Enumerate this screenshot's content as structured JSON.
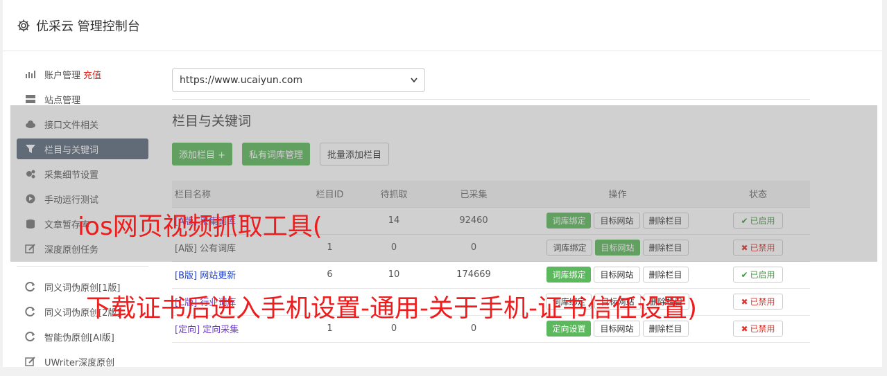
{
  "header": {
    "title": "优采云 管理控制台"
  },
  "sidebar": {
    "items": [
      {
        "label": "账户管理",
        "extra": "充值",
        "icon": "bar-chart-icon"
      },
      {
        "label": "站点管理",
        "icon": "server-icon"
      },
      {
        "label": "接口文件相关",
        "icon": "cloud-upload-icon"
      },
      {
        "label": "栏目与关键词",
        "icon": "filter-icon",
        "active": true
      },
      {
        "label": "采集细节设置",
        "icon": "cogs-icon"
      },
      {
        "label": "手动运行测试",
        "icon": "play-icon"
      },
      {
        "label": "文章暂存库",
        "icon": "database-icon"
      },
      {
        "label": "深度原创任务",
        "icon": "edit-icon"
      }
    ],
    "items2": [
      {
        "label": "同义词伪原创[1版]",
        "icon": "refresh-icon"
      },
      {
        "label": "同义词伪原创[2版]",
        "icon": "refresh-icon"
      },
      {
        "label": "智能伪原创[AI版]",
        "icon": "refresh-icon"
      },
      {
        "label": "UWriter深度原创",
        "icon": "edit-icon"
      }
    ]
  },
  "main": {
    "site_select": "https://www.ucaiyun.com",
    "section_title": "栏目与关键词",
    "buttons": {
      "add": "添加栏目 +",
      "private": "私有词库管理",
      "batch": "批量添加栏目"
    },
    "table": {
      "headers": [
        "栏目名称",
        "栏目ID",
        "待抓取",
        "已采集",
        "操作",
        "状态"
      ],
      "rows": [
        {
          "name": "[A版] 采集词库",
          "id": "",
          "pending": "14",
          "collected": "92460",
          "op1": "词库绑定",
          "op1_green": true,
          "op2": "目标网站",
          "op2_green": false,
          "op3": "删除栏目",
          "status": "已启用",
          "on": true,
          "name_color": "purple"
        },
        {
          "name": "[A版] 公有词库",
          "id": "1",
          "pending": "0",
          "collected": "0",
          "op1": "词库绑定",
          "op1_green": false,
          "op2": "目标网站",
          "op2_green": true,
          "op3": "删除栏目",
          "status": "已禁用",
          "on": false,
          "name_color": "plain"
        },
        {
          "name": "[B版] 网站更新",
          "id": "6",
          "pending": "10",
          "collected": "174669",
          "op1": "词库绑定",
          "op1_green": true,
          "op2": "目标网站",
          "op2_green": false,
          "op3": "删除栏目",
          "status": "已启用",
          "on": true,
          "name_color": "blue"
        },
        {
          "name": "[C版] 行业词库",
          "id": "",
          "pending": "",
          "collected": "",
          "op1": "词库绑定",
          "op1_green": false,
          "op2": "目标网站",
          "op2_green": false,
          "op3": "删除栏目",
          "status": "已禁用",
          "on": false,
          "name_color": "purple"
        },
        {
          "name": "[定向] 定向采集",
          "id": "1",
          "pending": "0",
          "collected": "0",
          "op1": "定向设置",
          "op1_green": true,
          "op2": "目标网站",
          "op2_green": false,
          "op3": "删除栏目",
          "status": "已禁用",
          "on": false,
          "name_color": "purple"
        }
      ]
    }
  },
  "watermark": {
    "line1": "ios网页视频抓取工具(",
    "line2": "下载证书后进入手机设置-通用-关于手机-证书信任设置)"
  },
  "colors": {
    "green": "#5cb85c",
    "active_nav": "#5b6a7c",
    "watermark": "#ee1c1c"
  }
}
